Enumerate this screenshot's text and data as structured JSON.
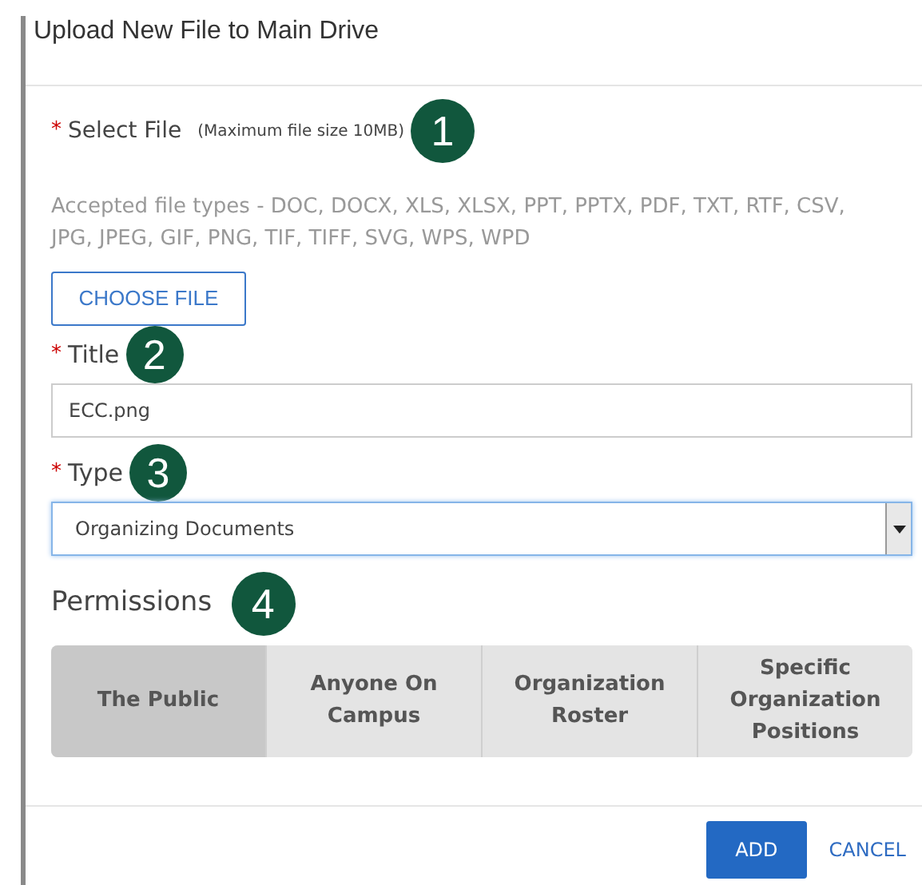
{
  "dialog": {
    "title": "Upload New File to Main Drive"
  },
  "select_file": {
    "required_mark": "*",
    "label": "Select File",
    "note": "(Maximum file size 10MB)",
    "badge": "1",
    "accepted": "Accepted file types - DOC, DOCX, XLS, XLSX, PPT, PPTX, PDF, TXT, RTF, CSV, JPG, JPEG, GIF, PNG, TIF, TIFF, SVG, WPS, WPD",
    "button": "CHOOSE FILE"
  },
  "title_field": {
    "required_mark": "*",
    "label": "Title",
    "badge": "2",
    "value": "ECC.png"
  },
  "type_field": {
    "required_mark": "*",
    "label": "Type",
    "badge": "3",
    "value": "Organizing Documents"
  },
  "permissions": {
    "heading": "Permissions",
    "badge": "4",
    "options": [
      {
        "label": "The Public",
        "selected": true
      },
      {
        "label": "Anyone On Campus",
        "selected": false
      },
      {
        "label": "Organization Roster",
        "selected": false
      },
      {
        "label": "Specific Organization Positions",
        "selected": false
      }
    ]
  },
  "buttons": [
    {
      "label": "ADD",
      "kind": "primary"
    },
    {
      "label": "CANCEL",
      "kind": "link"
    }
  ]
}
